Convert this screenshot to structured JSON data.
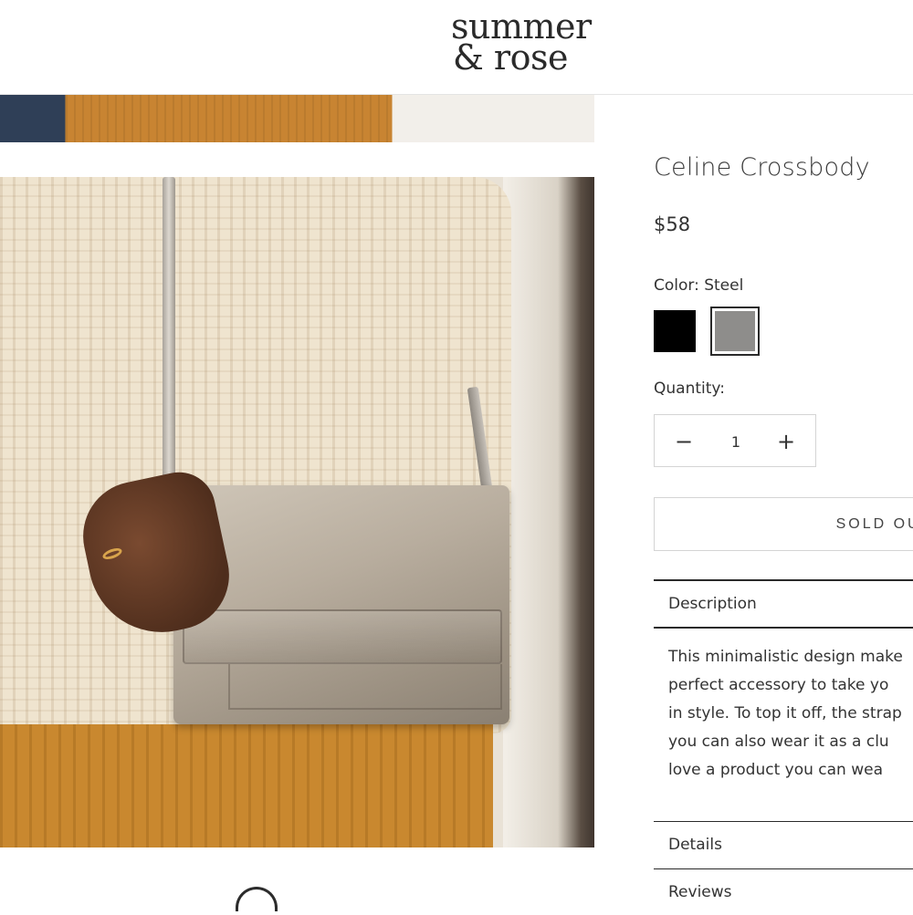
{
  "brand": {
    "logo_line1": "summer",
    "logo_line2": "& rose"
  },
  "product": {
    "title": "Celine Crossbody",
    "price": "$58",
    "color_label": "Color: Steel",
    "colors": [
      {
        "name": "Black",
        "hex": "#000000",
        "selected": false
      },
      {
        "name": "Steel",
        "hex": "#8e8d8b",
        "selected": true
      }
    ],
    "quantity_label": "Quantity:",
    "quantity_value": "1",
    "quantity_minus": "−",
    "quantity_plus": "+",
    "button_label": "SOLD OUT"
  },
  "accordion": {
    "description_label": "Description",
    "description_lines": [
      "This minimalistic design make",
      "perfect accessory to take yo",
      "in style. To top it off, the strap",
      "you can also wear it as a clu",
      "love a product you can wea"
    ],
    "details_label": "Details",
    "reviews_label": "Reviews"
  },
  "gallery": {
    "images": [
      "image-top-partial",
      "image-main-model-with-crossbody",
      "image-bottom-partial"
    ]
  },
  "colors": {
    "text": "#2b2b2b",
    "border": "#d4d4d4",
    "accent_dark": "#2a2a2a"
  }
}
